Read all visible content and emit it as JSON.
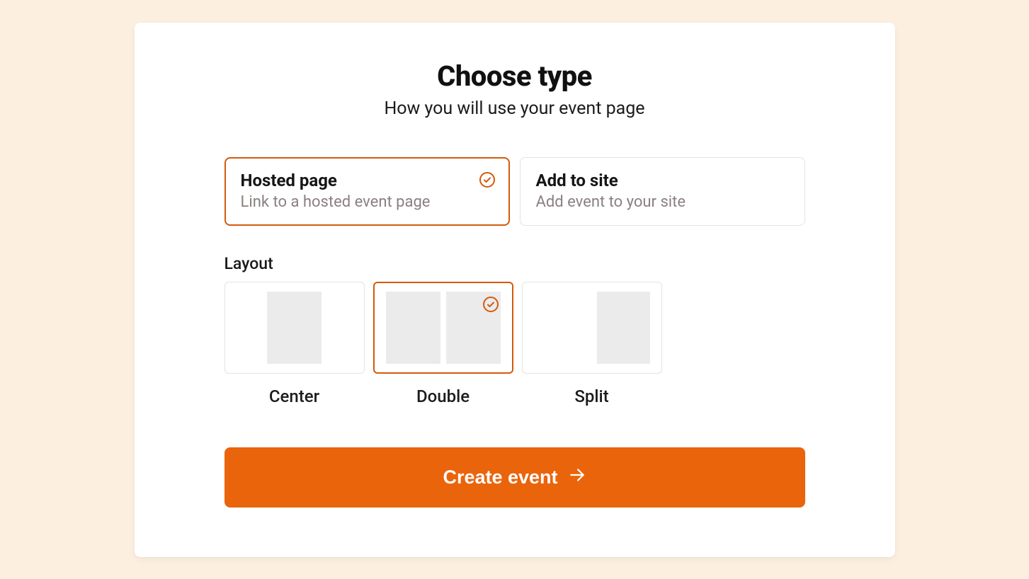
{
  "header": {
    "title": "Choose type",
    "subtitle": "How you will use your event page"
  },
  "type_options": [
    {
      "title": "Hosted page",
      "desc": "Link to a hosted event page",
      "selected": true
    },
    {
      "title": "Add to site",
      "desc": "Add event to your site",
      "selected": false
    }
  ],
  "layout_section": {
    "label": "Layout",
    "options": [
      {
        "label": "Center",
        "selected": false
      },
      {
        "label": "Double",
        "selected": true
      },
      {
        "label": "Split",
        "selected": false
      }
    ]
  },
  "cta": {
    "label": "Create event"
  },
  "colors": {
    "accent": "#ea640c",
    "accent_border": "#d35a0b",
    "background": "#fcefe0",
    "muted_text": "#8b7f80"
  }
}
